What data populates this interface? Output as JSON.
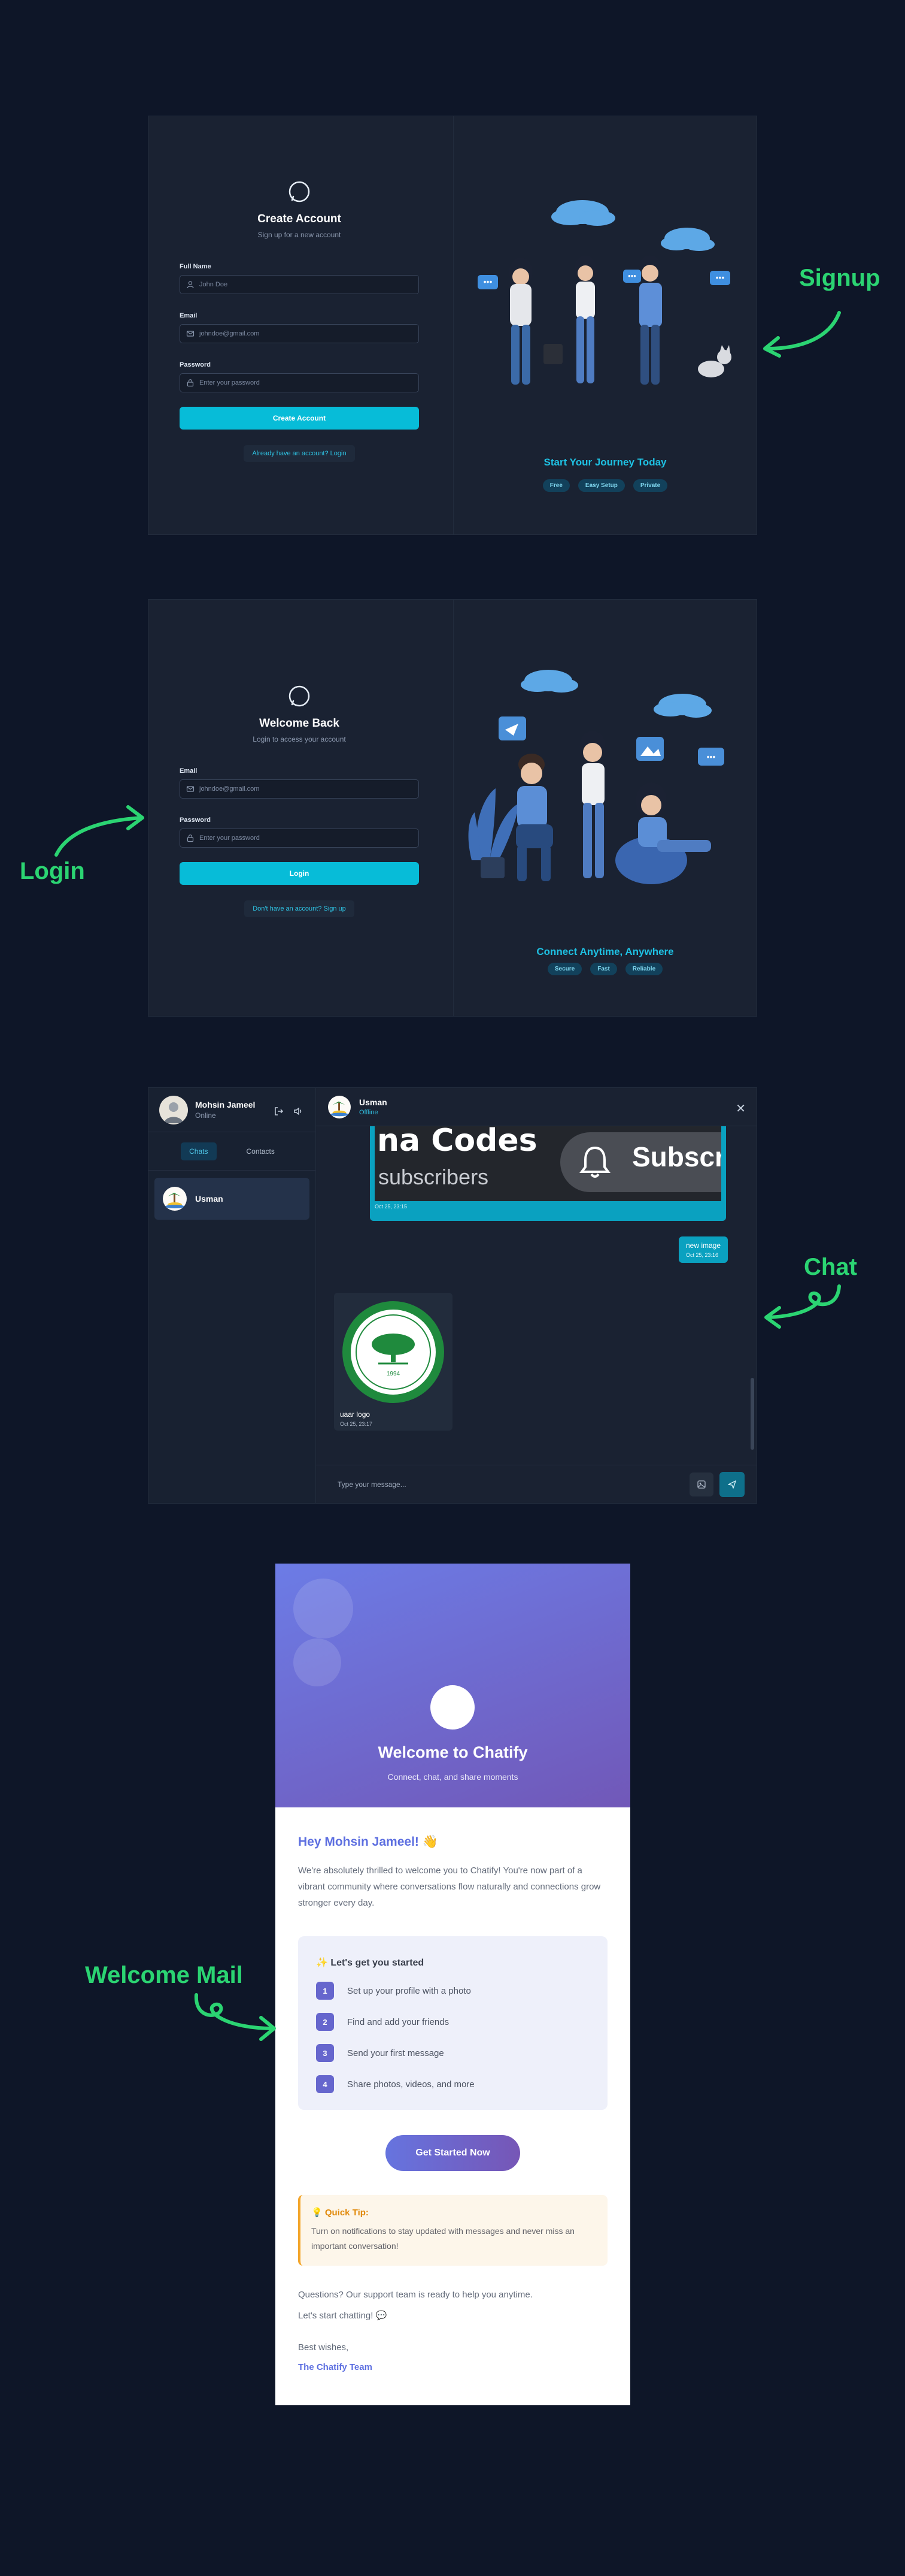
{
  "signup": {
    "title": "Create Account",
    "subtitle": "Sign up for a new account",
    "full_name_label": "Full Name",
    "full_name_placeholder": "John Doe",
    "email_label": "Email",
    "email_placeholder": "johndoe@gmail.com",
    "password_label": "Password",
    "password_placeholder": "Enter your password",
    "submit_label": "Create Account",
    "switch_link": "Already have an account? Login",
    "tagline": "Start Your Journey Today",
    "badges": [
      "Free",
      "Easy Setup",
      "Private"
    ]
  },
  "login": {
    "title": "Welcome Back",
    "subtitle": "Login to access your account",
    "email_label": "Email",
    "email_placeholder": "johndoe@gmail.com",
    "password_label": "Password",
    "password_placeholder": "Enter your password",
    "submit_label": "Login",
    "switch_link": "Don't have an account? Sign up",
    "tagline": "Connect Anytime, Anywhere",
    "badges": [
      "Secure",
      "Fast",
      "Reliable"
    ]
  },
  "chat": {
    "me": {
      "name": "Mohsin Jameel",
      "status": "Online"
    },
    "tabs": [
      "Chats",
      "Contacts"
    ],
    "contacts": [
      {
        "name": "Usman"
      }
    ],
    "header": {
      "name": "Usman",
      "status": "Offline"
    },
    "messages": [
      {
        "type": "image",
        "direction": "outgoing",
        "image_text": [
          "na Codes",
          "subscribers",
          "Subscri"
        ],
        "time": "Oct 25, 23:15"
      },
      {
        "type": "text",
        "direction": "outgoing",
        "text": "new image",
        "time": "Oct 25, 23:16"
      },
      {
        "type": "image",
        "direction": "incoming",
        "caption": "uaar logo",
        "time": "Oct 25, 23:17",
        "logo_year": "1994"
      }
    ],
    "composer_placeholder": "Type your message..."
  },
  "email": {
    "hero_title": "Welcome to Chatify",
    "hero_subtitle": "Connect, chat, and share moments",
    "greeting": "Hey Mohsin Jameel! 👋",
    "intro": "We're absolutely thrilled to welcome you to Chatify! You're now part of a vibrant community where conversations flow naturally and connections grow stronger every day.",
    "steps_title": "✨ Let's get you started",
    "steps": [
      {
        "num": "1",
        "text": "Set up your profile with a photo"
      },
      {
        "num": "2",
        "text": "Find and add your friends"
      },
      {
        "num": "3",
        "text": "Send your first message"
      },
      {
        "num": "4",
        "text": "Share photos, videos, and more"
      }
    ],
    "cta": "Get Started Now",
    "tip_title": "💡 Quick Tip:",
    "tip_text": "Turn on notifications to stay updated with messages and never miss an important conversation!",
    "support": "Questions? Our support team is ready to help you anytime.",
    "closing": "Let's start chatting! 💬",
    "signoff": "Best wishes,",
    "team": "The Chatify Team"
  },
  "annotations": {
    "signup": "Signup",
    "login": "Login",
    "chat": "Chat",
    "welcome_mail": "Welcome Mail"
  },
  "colors": {
    "page_bg": "#0e1628",
    "accent_cyan": "#07bcd8",
    "annotation_green": "#2bd472",
    "mail_purple": "#6c7ce6"
  }
}
